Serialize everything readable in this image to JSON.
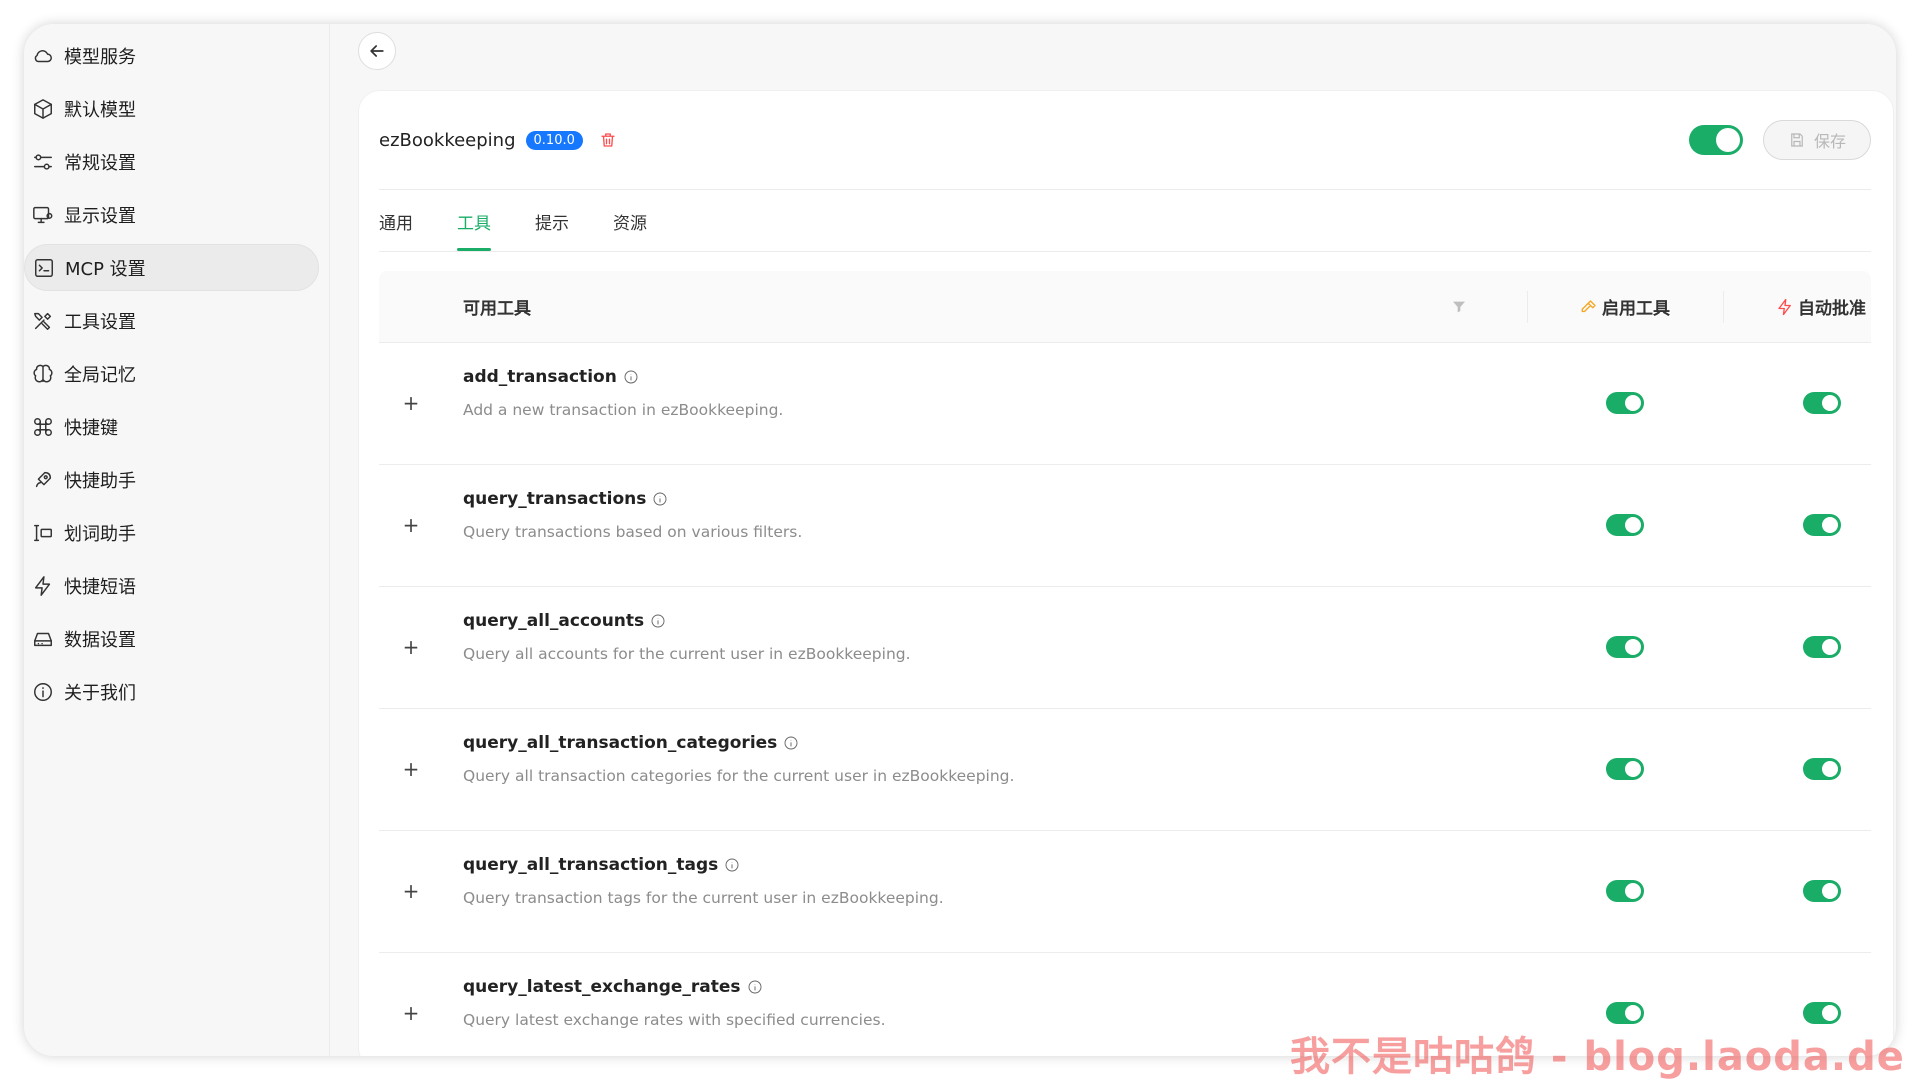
{
  "sidebar": {
    "items": [
      {
        "label": "模型服务",
        "icon": "cloud-icon"
      },
      {
        "label": "默认模型",
        "icon": "cube-icon"
      },
      {
        "label": "常规设置",
        "icon": "sliders-icon"
      },
      {
        "label": "显示设置",
        "icon": "monitor-icon"
      },
      {
        "label": "MCP 设置",
        "icon": "terminal-icon"
      },
      {
        "label": "工具设置",
        "icon": "tools-icon"
      },
      {
        "label": "全局记忆",
        "icon": "brain-icon"
      },
      {
        "label": "快捷键",
        "icon": "command-icon"
      },
      {
        "label": "快捷助手",
        "icon": "rocket-icon"
      },
      {
        "label": "划词助手",
        "icon": "text-select-icon"
      },
      {
        "label": "快捷短语",
        "icon": "zap-icon"
      },
      {
        "label": "数据设置",
        "icon": "hard-drive-icon"
      },
      {
        "label": "关于我们",
        "icon": "info-icon"
      }
    ],
    "active_index": 4
  },
  "header": {
    "server_name": "ezBookkeeping",
    "version": "0.10.0",
    "enabled": true,
    "save_label": "保存"
  },
  "tabs": [
    {
      "label": "通用"
    },
    {
      "label": "工具"
    },
    {
      "label": "提示"
    },
    {
      "label": "资源"
    }
  ],
  "active_tab": 1,
  "table": {
    "col_tools": "可用工具",
    "col_enable": "启用工具",
    "col_approve": "自动批准",
    "rows": [
      {
        "name": "add_transaction",
        "desc": "Add a new transaction in ezBookkeeping.",
        "enabled": true,
        "auto_approve": true
      },
      {
        "name": "query_transactions",
        "desc": "Query transactions based on various filters.",
        "enabled": true,
        "auto_approve": true
      },
      {
        "name": "query_all_accounts",
        "desc": "Query all accounts for the current user in ezBookkeeping.",
        "enabled": true,
        "auto_approve": true
      },
      {
        "name": "query_all_transaction_categories",
        "desc": "Query all transaction categories for the current user in ezBookkeeping.",
        "enabled": true,
        "auto_approve": true
      },
      {
        "name": "query_all_transaction_tags",
        "desc": "Query transaction tags for the current user in ezBookkeeping.",
        "enabled": true,
        "auto_approve": true
      },
      {
        "name": "query_latest_exchange_rates",
        "desc": "Query latest exchange rates with specified currencies.",
        "enabled": true,
        "auto_approve": true
      }
    ]
  },
  "colors": {
    "accent": "#1aad67",
    "badge": "#1677ff",
    "danger": "#ff4d4f"
  },
  "watermark": "我不是咕咕鸽 - blog.laoda.de"
}
